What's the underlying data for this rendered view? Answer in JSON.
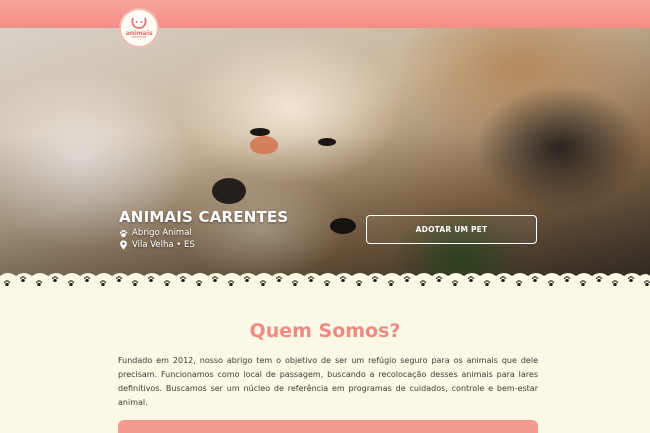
{
  "brand": {
    "logo_text": "animais",
    "logo_sub": "carentes"
  },
  "hero": {
    "title": "ANIMAIS CARENTES",
    "subtitle": "Abrigo Animal",
    "location": "Vila Velha • ES",
    "button_label": "ADOTAR UM PET"
  },
  "about": {
    "heading": "Quem Somos?",
    "text": "Fundado em 2012, nosso abrigo tem o objetivo de ser um refúgio seguro para os animais que dele precisam. Funcionamos como local de passagem, buscando a recolocação desses animais para lares definitivos. Buscamos ser um núcleo de referência em programas de cuidados, controle e bem-estar animal."
  },
  "colors": {
    "accent": "#ef8a83",
    "topbar": "#f48d86",
    "background": "#fbf8e6"
  },
  "icons": {
    "subtitle_icon": "paw-icon",
    "location_icon": "map-pin-icon"
  }
}
